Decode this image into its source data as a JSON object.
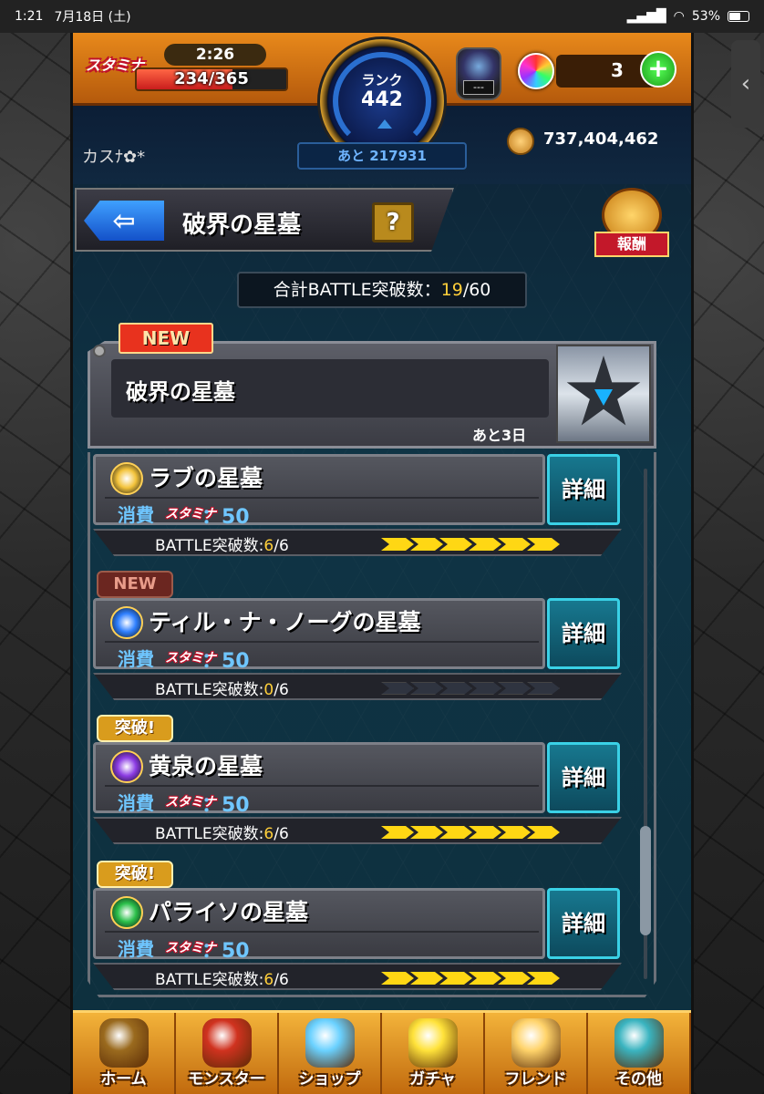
{
  "status_bar": {
    "time": "1:21",
    "date": "7月18日 (土)",
    "battery": "53%"
  },
  "header": {
    "stamina_logo": "スタミナ",
    "timer": "2:26",
    "stamina": "234/365",
    "stamina_fill": 0.64,
    "rank_label": "ランク",
    "rank_value": "442",
    "rank_next": "あと 217931",
    "device_text": "---",
    "orb_count": "3",
    "plus": "+",
    "user_name": "カスﾅ✿*",
    "coins": "737,404,462"
  },
  "title_bar": {
    "back": "⇦",
    "title": "破界の星墓",
    "help": "?",
    "reward_label": "報酬"
  },
  "total": {
    "prefix": "合計BATTLE突破数：",
    "current": "19",
    "suffix": "/60"
  },
  "featured": {
    "new_tag": "NEW",
    "title": "破界の星墓",
    "remaining": "あと3日"
  },
  "quests": [
    {
      "tag": "",
      "name": "ラブの星墓",
      "cost_label": "消費",
      "stam": "スタミナ",
      "cost": "：50",
      "prog_prefix": "BATTLE突破数:",
      "prog_value": "6",
      "prog_total": "/6",
      "filled": 6,
      "detail": "詳細",
      "icon_color": "#f3c33b"
    },
    {
      "tag": "NEW",
      "name": "ティル・ナ・ノーグの星墓",
      "cost_label": "消費",
      "stam": "スタミナ",
      "cost": "：50",
      "prog_prefix": "BATTLE突破数:",
      "prog_value": "0",
      "prog_total": "/6",
      "filled": 0,
      "detail": "詳細",
      "icon_color": "#2e7fff"
    },
    {
      "tag": "突破!",
      "name": "黄泉の星墓",
      "cost_label": "消費",
      "stam": "スタミナ",
      "cost": "：50",
      "prog_prefix": "BATTLE突破数:",
      "prog_value": "6",
      "prog_total": "/6",
      "filled": 6,
      "detail": "詳細",
      "icon_color": "#8b3be3"
    },
    {
      "tag": "突破!",
      "name": "パライソの星墓",
      "cost_label": "消費",
      "stam": "スタミナ",
      "cost": "：50",
      "prog_prefix": "BATTLE突破数:",
      "prog_value": "6",
      "prog_total": "/6",
      "filled": 6,
      "detail": "詳細",
      "icon_color": "#2bc04a"
    }
  ],
  "nav": [
    {
      "label": "ホーム",
      "color": "#9a6a1e"
    },
    {
      "label": "モンスター",
      "color": "#d0321f"
    },
    {
      "label": "ショップ",
      "color": "#6ad1ff"
    },
    {
      "label": "ガチャ",
      "color": "#ffe23a"
    },
    {
      "label": "フレンド",
      "color": "#ffd36a"
    },
    {
      "label": "その他",
      "color": "#3ab4c0"
    }
  ]
}
